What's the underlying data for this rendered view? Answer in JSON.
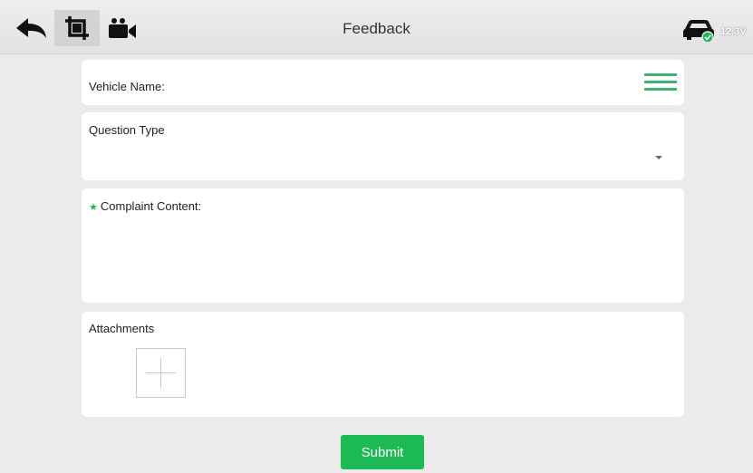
{
  "header": {
    "title": "Feedback",
    "voltage": "12.3V",
    "icons": [
      "back-arrow-icon",
      "crop-icon",
      "video-camera-icon",
      "car-connected-icon"
    ]
  },
  "form": {
    "vehicle_name_label": "Vehicle Name:",
    "question_type_label": "Question Type",
    "complaint_required_mark": "★",
    "complaint_label": "Complaint Content:",
    "attachments_label": "Attachments"
  },
  "actions": {
    "submit_label": "Submit"
  },
  "colors": {
    "accent": "#1db954",
    "menu_green": "#3cb371",
    "background": "#ebebeb",
    "topbar": "#e6e6e6"
  }
}
